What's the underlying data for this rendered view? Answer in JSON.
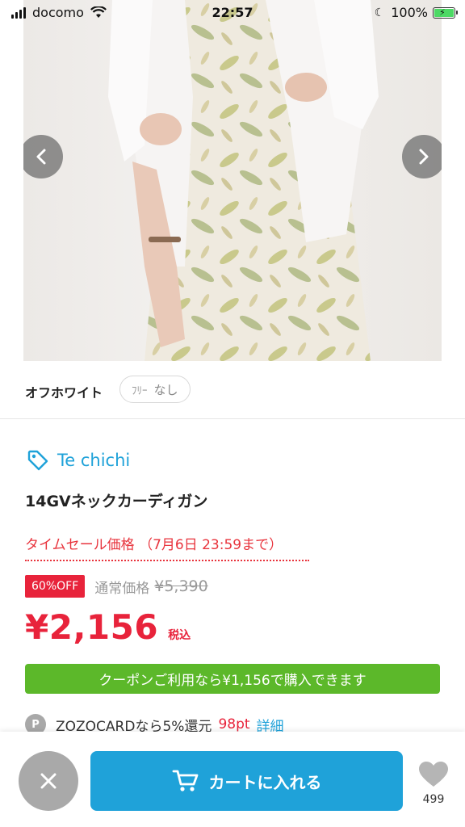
{
  "status_bar": {
    "carrier": "docomo",
    "time": "22:57",
    "battery": "100%",
    "icons": [
      "signal-icon",
      "wifi-icon",
      "moon-icon",
      "battery-charging-icon"
    ]
  },
  "product": {
    "color": "オフホワイト",
    "size_name": "ﾌﾘｰ",
    "stock_status": "なし",
    "brand": "Te chichi",
    "name": "14GVネックカーディガン",
    "timesale": "タイムセール価格 （7月6日 23:59まで）",
    "discount": "60%OFF",
    "regular_label": "通常価格",
    "regular_price": "¥5,390",
    "sale_price": "¥2,156",
    "tax_label": "税込",
    "coupon": "クーポンご利用なら¥1,156で購入できます",
    "card_icon_label": "P",
    "card_text": "ZOZOCARDなら5%還元",
    "points": "98pt",
    "detail_link": "詳細"
  },
  "bottom_bar": {
    "cart_label": "カートに入れる",
    "fav_count": "499"
  },
  "colors": {
    "accent_blue": "#1fa2d9",
    "sale_red": "#e8233b",
    "coupon_green": "#5cb82a"
  }
}
